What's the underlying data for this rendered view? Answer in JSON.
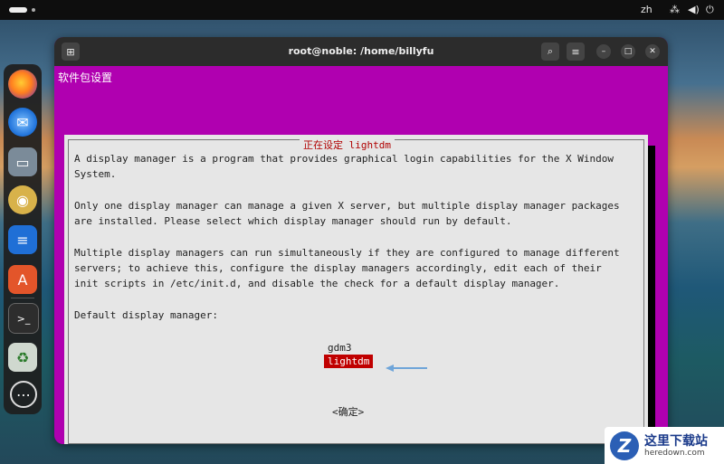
{
  "topbar": {
    "lang": "zh"
  },
  "window": {
    "title": "root@noble: /home/billyfu"
  },
  "terminal": {
    "package_config_title": "软件包设置",
    "dialog": {
      "title": "正在设定 lightdm",
      "paragraphs": [
        "A display manager is a program that provides graphical login capabilities for the X Window\nSystem.",
        "Only one display manager can manage a given X server, but multiple display manager packages\nare installed. Please select which display manager should run by default.",
        "Multiple display managers can run simultaneously if they are configured to manage different\nservers; to achieve this, configure the display managers accordingly, edit each of their\ninit scripts in /etc/init.d, and disable the check for a default display manager.",
        "Default display manager:"
      ],
      "options": [
        "gdm3",
        "lightdm"
      ],
      "selected": "lightdm",
      "ok_label": "<确定>"
    }
  },
  "dock": {
    "apps": [
      "firefox-icon",
      "thunderbird-icon",
      "files-icon",
      "rhythmbox-icon",
      "writer-icon",
      "app-center-icon",
      "terminal-icon",
      "trash-icon",
      "ubuntu-apps-icon"
    ]
  },
  "watermark": {
    "cn": "这里下载站",
    "en": "heredown.com",
    "logo": "Z"
  },
  "colors": {
    "dialog_bg": "#e6e6e6",
    "terminal_bg": "#b000b0",
    "selection": "#c00000",
    "title_red": "#b00000"
  }
}
